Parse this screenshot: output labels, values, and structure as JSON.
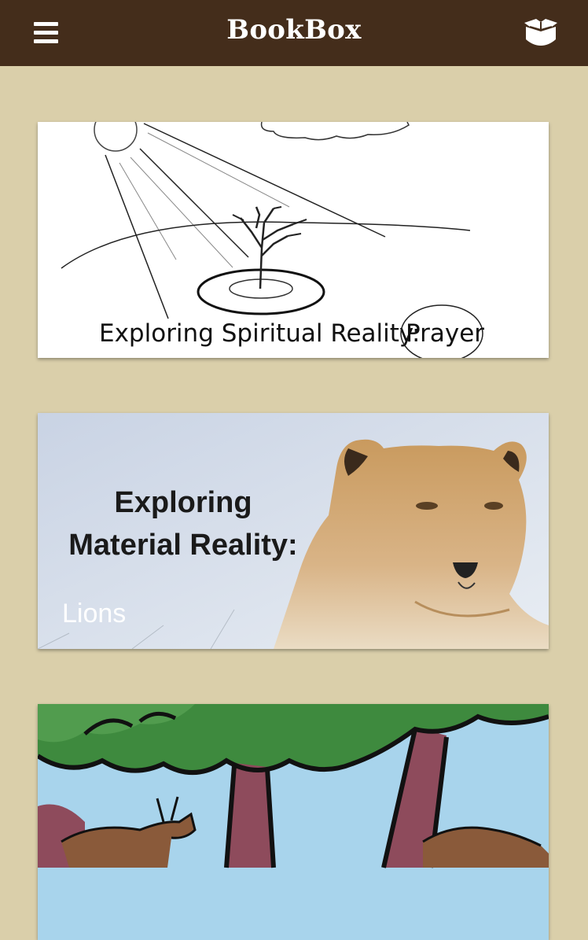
{
  "header": {
    "title": "BookBox",
    "menu_icon": "hamburger-menu-icon",
    "library_icon": "open-box-icon",
    "background": "#442D1B"
  },
  "page": {
    "background": "#DACFAA"
  },
  "books": [
    {
      "cover_text": "Exploring Spiritual Reality:",
      "cover_word": "Prayer",
      "title": ""
    },
    {
      "cover_line1": "Exploring",
      "cover_line2": "Material Reality:",
      "title": "Lions"
    },
    {
      "title": ""
    }
  ]
}
